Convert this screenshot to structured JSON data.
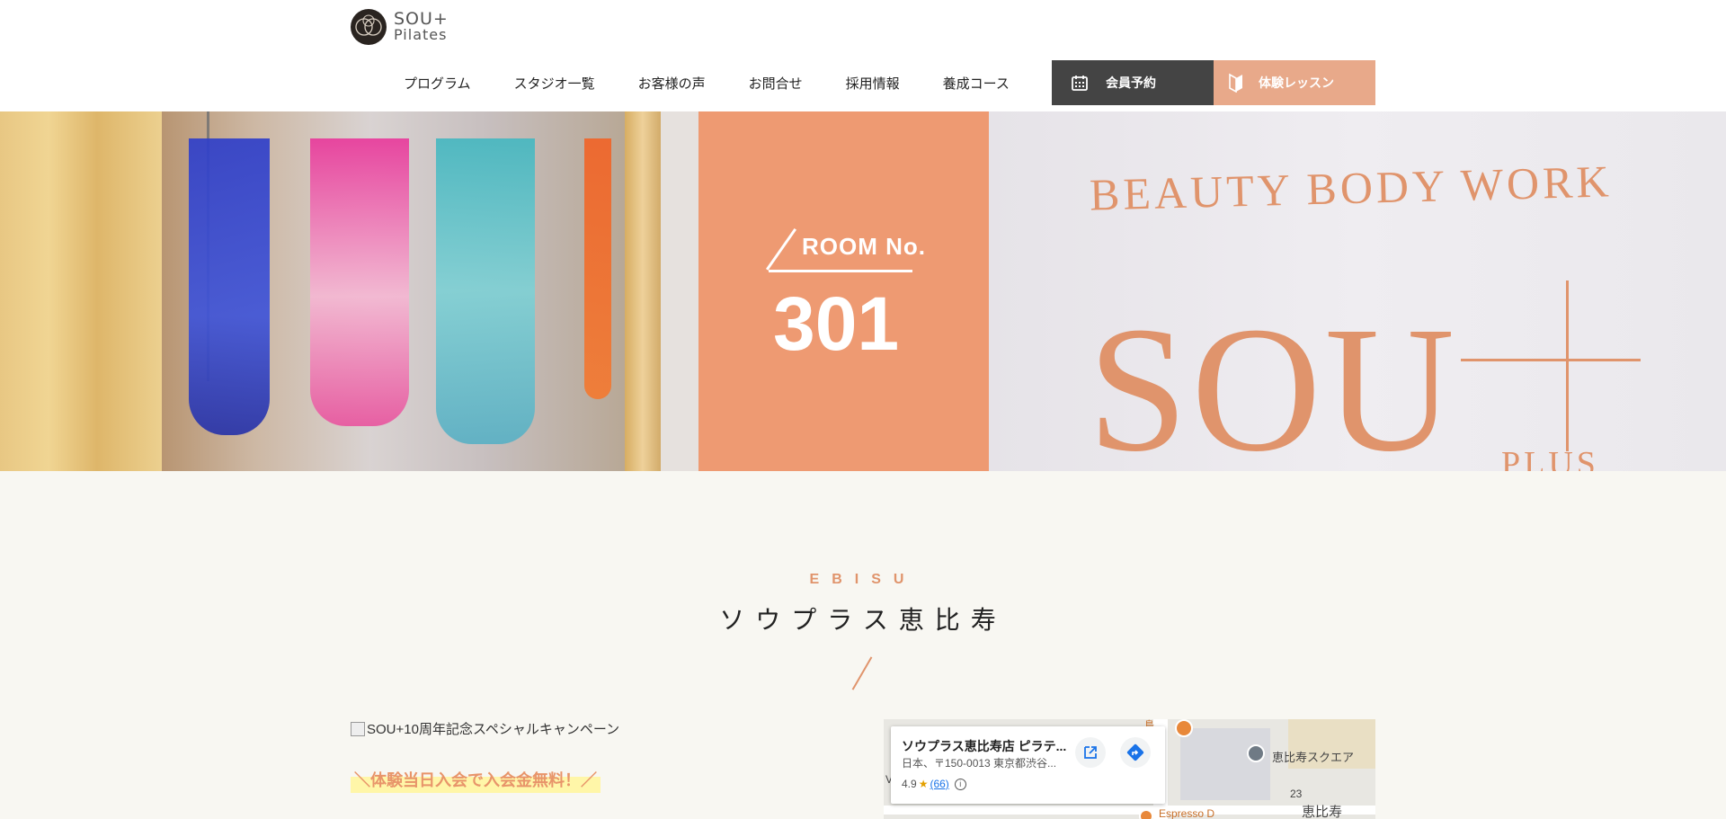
{
  "brand": {
    "line1": "SOU+",
    "line2": "Pilates"
  },
  "nav": [
    "プログラム",
    "スタジオ一覧",
    "お客様の声",
    "お問合せ",
    "採用情報",
    "養成コース"
  ],
  "buttons": {
    "reserve": "会員予約",
    "trial": "体験レッスン"
  },
  "hero": {
    "room_label": "ROOM No.",
    "room_number": "301",
    "sign_top": "BEAUTY BODY WORK",
    "sign_big": "SOU",
    "sign_small": "PLUS"
  },
  "section": {
    "subtitle_en": "EBISU",
    "title_jp": "ソウプラス恵比寿"
  },
  "campaign": {
    "image_alt": "SOU+10周年記念スペシャルキャンペーン",
    "headline": "＼体験当日入会で入会金無料！／"
  },
  "map": {
    "title": "ソウプラス恵比寿店 ピラテ...",
    "address": "日本、〒150-0013 東京都渋谷...",
    "rating": "4.9",
    "review_count": "(66)",
    "info": "i",
    "labels": {
      "square": "恵比寿スクエア",
      "number": "23",
      "ebisu": "恵比寿",
      "espresso": "Espresso D",
      "top": "島",
      "left": "V"
    }
  },
  "colors": {
    "accent": "#e0946c",
    "dark_button": "#444444",
    "trial_button": "#e8a98a"
  }
}
